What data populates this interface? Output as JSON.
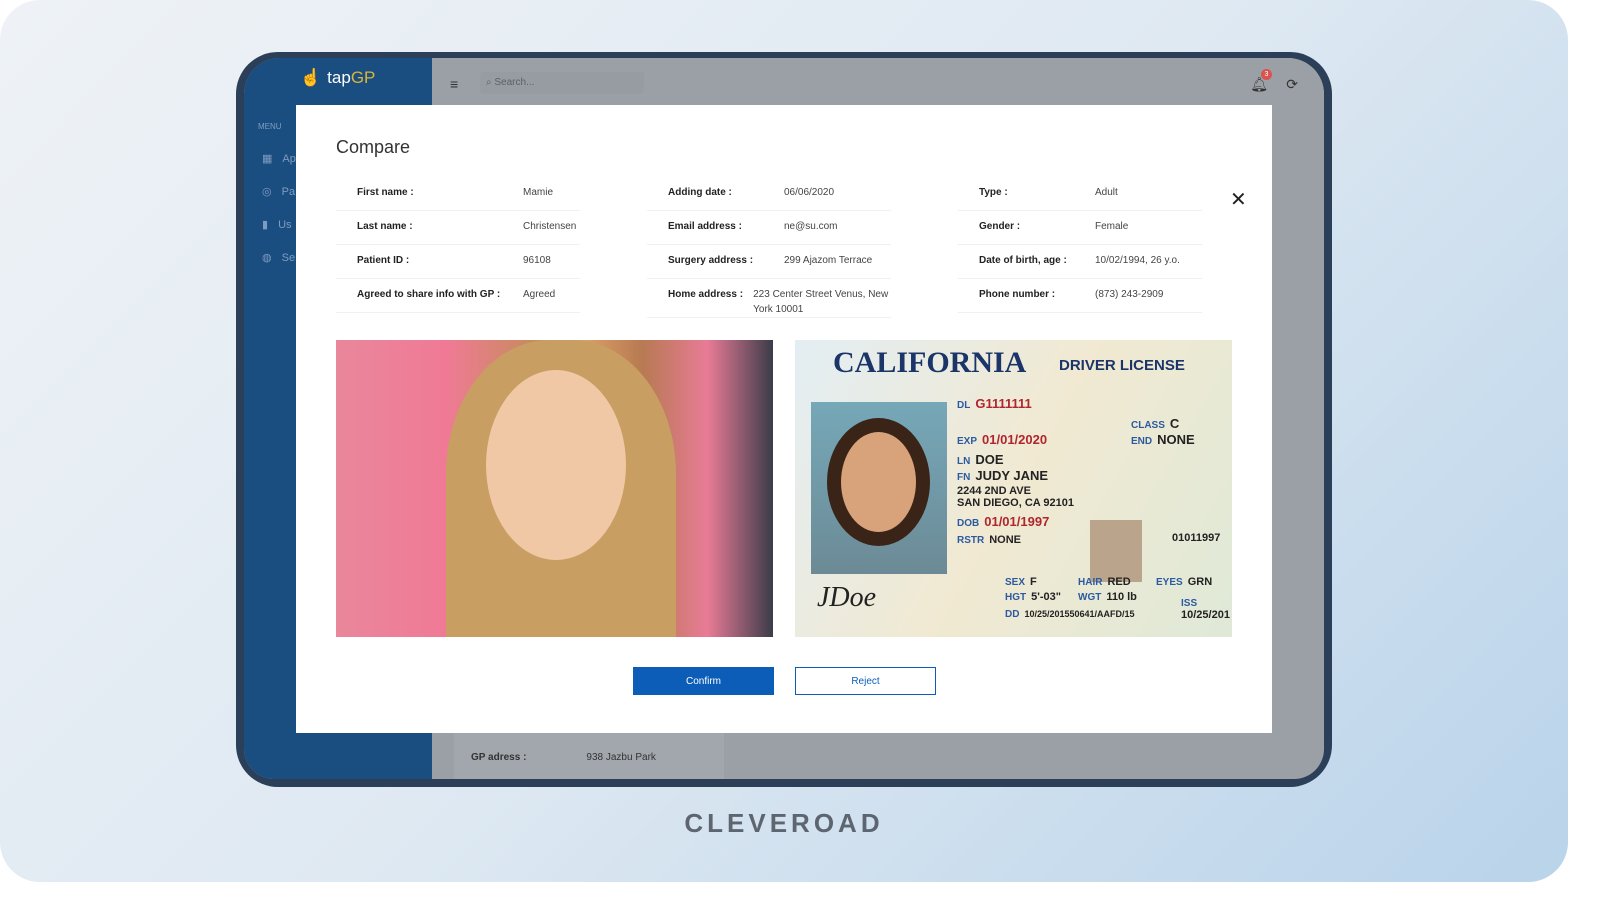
{
  "app": {
    "logo_prefix": "tap",
    "logo_suffix": "GP",
    "menu_label": "MENU",
    "search_placeholder": "Search...",
    "notification_count": "3",
    "sidebar": [
      {
        "icon": "calendar-icon",
        "label": "Ap"
      },
      {
        "icon": "user-circle-icon",
        "label": "Pa"
      },
      {
        "icon": "bar-chart-icon",
        "label": "Us"
      },
      {
        "icon": "globe-icon",
        "label": "Se"
      }
    ],
    "background_card": {
      "label": "GP adress :",
      "value": "938 Jazbu Park"
    }
  },
  "modal": {
    "title": "Compare",
    "columns": [
      [
        {
          "k": "First name :",
          "v": "Mamie"
        },
        {
          "k": "Last name :",
          "v": "Christensen"
        },
        {
          "k": "Patient ID :",
          "v": "96108"
        },
        {
          "k": "Agreed to share info with GP :",
          "v": "Agreed"
        }
      ],
      [
        {
          "k": "Adding date :",
          "v": "06/06/2020"
        },
        {
          "k": "Email address :",
          "v": "ne@su.com"
        },
        {
          "k": "Surgery address :",
          "v": "299 Ajazom Terrace"
        },
        {
          "k": "Home address :",
          "v": "223 Center Street Venus, New York 10001"
        }
      ],
      [
        {
          "k": "Type :",
          "v": "Adult"
        },
        {
          "k": "Gender :",
          "v": "Female"
        },
        {
          "k": "Date of birth, age :",
          "v": "10/02/1994, 26 y.o."
        },
        {
          "k": "Phone number :",
          "v": "(873) 243-2909"
        }
      ]
    ],
    "license": {
      "state": "CALIFORNIA",
      "type": "DRIVER LICENSE",
      "dl": "G1111111",
      "exp": "01/01/2020",
      "ln": "DOE",
      "fn": "JUDY JANE",
      "addr1": "2244 2ND AVE",
      "addr2": "SAN DIEGO, CA 92101",
      "dob": "01/01/1997",
      "rstr": "NONE",
      "class": "C",
      "end": "NONE",
      "num": "01011997",
      "sex": "F",
      "hair": "RED",
      "eyes": "GRN",
      "hgt": "5'-03\"",
      "wgt": "110 lb",
      "dd": "10/25/201550641/AAFD/15",
      "iss": "10/25/201",
      "signature": "JDoe"
    },
    "confirm_label": "Confirm",
    "reject_label": "Reject"
  },
  "brand": "CLEVEROAD",
  "colors": {
    "primary": "#0c5db8",
    "sidebar": "#1b4e80"
  }
}
